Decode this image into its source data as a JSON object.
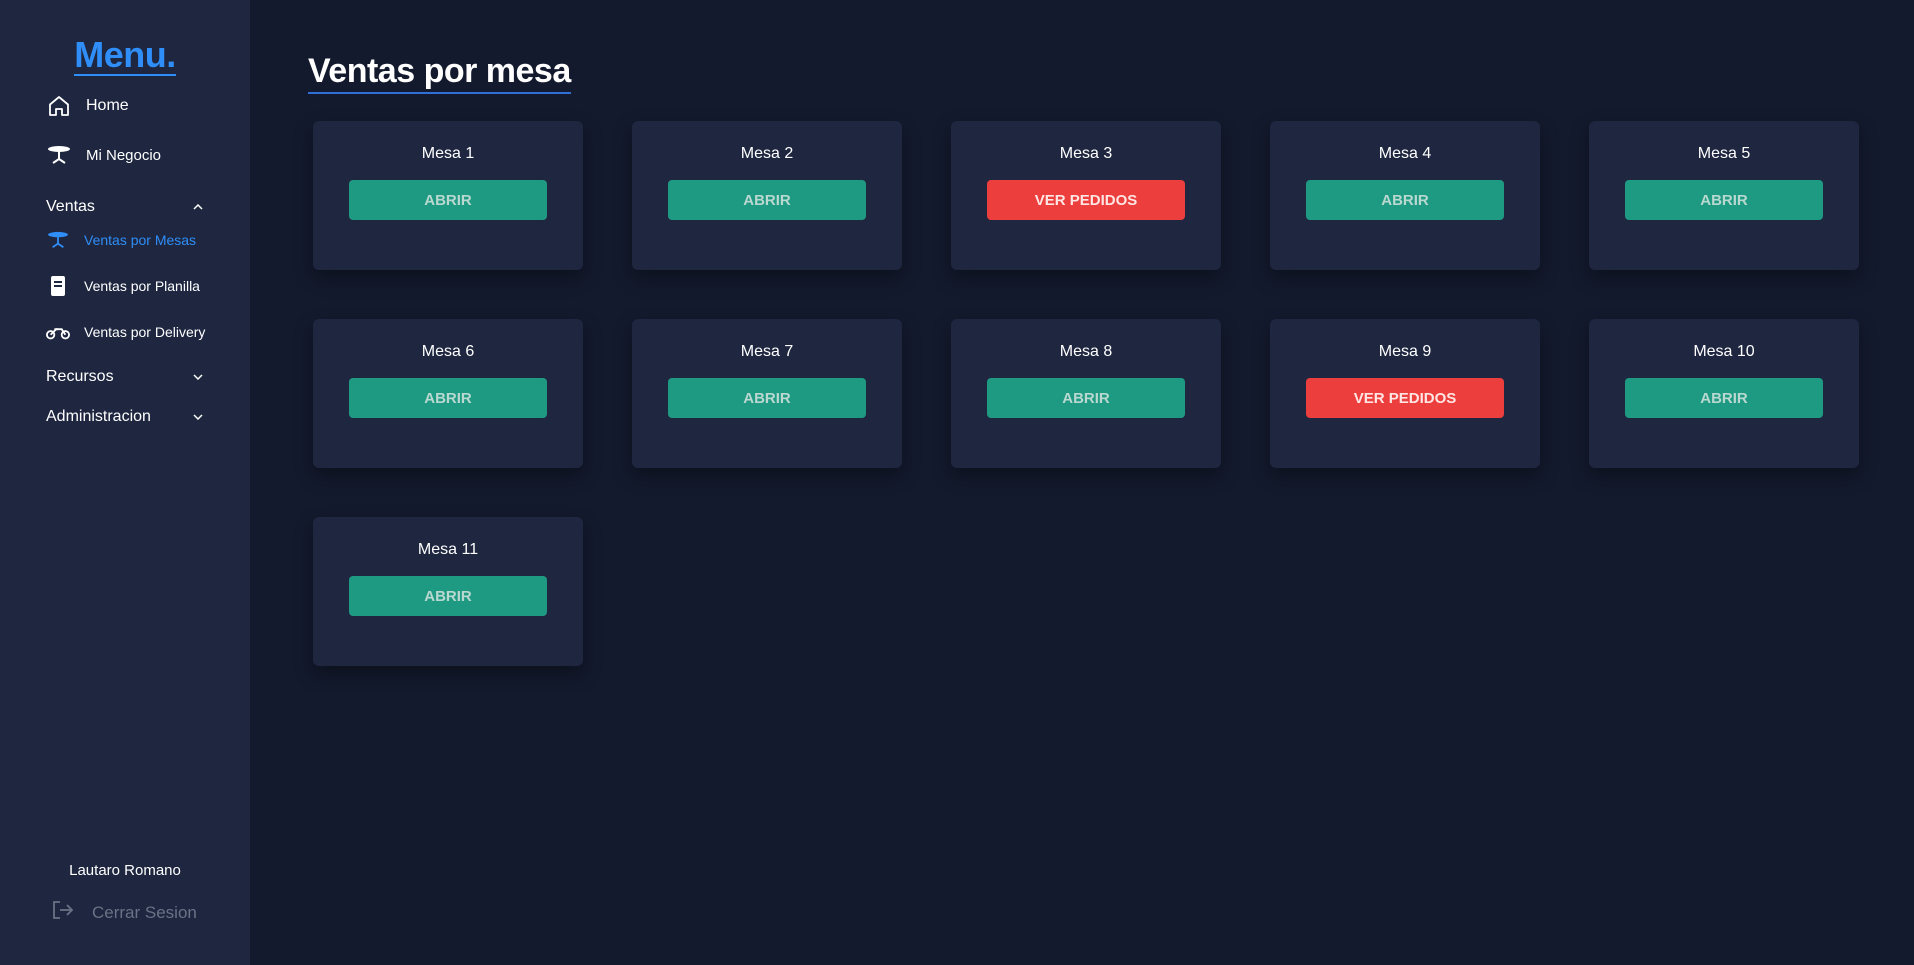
{
  "sidebar": {
    "brand": "Menu.",
    "home_label": "Home",
    "negocio_label": "Mi Negocio",
    "sections": {
      "ventas": "Ventas",
      "recursos": "Recursos",
      "administracion": "Administracion"
    },
    "ventas_items": {
      "mesas": "Ventas por Mesas",
      "planilla": "Ventas por Planilla",
      "delivery": "Ventas por Delivery"
    },
    "user_name": "Lautaro Romano",
    "logout_label": "Cerrar Sesion"
  },
  "main": {
    "title": "Ventas por mesa",
    "tables": [
      {
        "name": "Mesa 1",
        "action": "ABRIR",
        "status": "free"
      },
      {
        "name": "Mesa 2",
        "action": "ABRIR",
        "status": "free"
      },
      {
        "name": "Mesa 3",
        "action": "VER PEDIDOS",
        "status": "occupied"
      },
      {
        "name": "Mesa 4",
        "action": "ABRIR",
        "status": "free"
      },
      {
        "name": "Mesa 5",
        "action": "ABRIR",
        "status": "free"
      },
      {
        "name": "Mesa 6",
        "action": "ABRIR",
        "status": "free"
      },
      {
        "name": "Mesa 7",
        "action": "ABRIR",
        "status": "free"
      },
      {
        "name": "Mesa 8",
        "action": "ABRIR",
        "status": "free"
      },
      {
        "name": "Mesa 9",
        "action": "VER PEDIDOS",
        "status": "occupied"
      },
      {
        "name": "Mesa 10",
        "action": "ABRIR",
        "status": "free"
      },
      {
        "name": "Mesa 11",
        "action": "ABRIR",
        "status": "free"
      }
    ]
  },
  "colors": {
    "accent": "#2f8ef7",
    "open_button": "#1f9a82",
    "orders_button": "#ec3e3c",
    "sidebar_bg": "#1e2640",
    "page_bg": "#131a2d"
  }
}
